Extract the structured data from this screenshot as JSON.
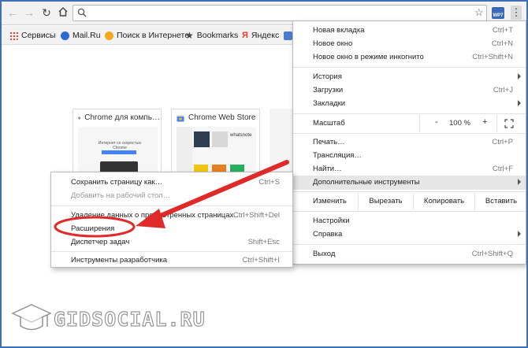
{
  "toolbar": {
    "address_value": "",
    "menu_glyph": "⋮",
    "ext_badge": "WP7"
  },
  "bookmarks": [
    {
      "label": "Сервисы",
      "color": "#e04b3b"
    },
    {
      "label": "Mail.Ru",
      "color": "#2a6bd6"
    },
    {
      "label": "Поиск в Интернете",
      "color": "#f2a91a"
    },
    {
      "label": "Bookmarks",
      "color": "#444444"
    },
    {
      "label": "Яндекс",
      "color": "#e23b2f"
    }
  ],
  "tiles": [
    {
      "title": "Chrome для компь…",
      "thumb_text": "Интернет со скоростью Chrome"
    },
    {
      "title": "Chrome Web Store",
      "thumb_text": "whatsnote"
    }
  ],
  "main_menu": {
    "new_tab": {
      "label": "Новая вкладка",
      "shortcut": "Ctrl+T"
    },
    "new_window": {
      "label": "Новое окно",
      "shortcut": "Ctrl+N"
    },
    "incognito": {
      "label": "Новое окно в режиме инкогнито",
      "shortcut": "Ctrl+Shift+N"
    },
    "history": {
      "label": "История"
    },
    "downloads": {
      "label": "Загрузки",
      "shortcut": "Ctrl+J"
    },
    "bookmarks": {
      "label": "Закладки"
    },
    "zoom": {
      "label": "Масштаб",
      "minus": "-",
      "value": "100 %",
      "plus": "+"
    },
    "print": {
      "label": "Печать…",
      "shortcut": "Ctrl+P"
    },
    "cast": {
      "label": "Трансляция…"
    },
    "find": {
      "label": "Найти…",
      "shortcut": "Ctrl+F"
    },
    "more_tools": {
      "label": "Дополнительные инструменты"
    },
    "edit": {
      "label": "Изменить",
      "cut": "Вырезать",
      "copy": "Копировать",
      "paste": "Вставить"
    },
    "settings": {
      "label": "Настройки"
    },
    "help": {
      "label": "Справка"
    },
    "exit": {
      "label": "Выход",
      "shortcut": "Ctrl+Shift+Q"
    }
  },
  "sub_menu": {
    "save_page": {
      "label": "Сохранить страницу как…",
      "shortcut": "Ctrl+S"
    },
    "add_desktop": {
      "label": "Добавить на рабочий стол…"
    },
    "clear_data": {
      "label": "Удаление данных о просмотренных страницах…",
      "shortcut": "Ctrl+Shift+Del"
    },
    "extensions": {
      "label": "Расширения"
    },
    "task_manager": {
      "label": "Диспетчер задач",
      "shortcut": "Shift+Esc"
    },
    "dev_tools": {
      "label": "Инструменты разработчика",
      "shortcut": "Ctrl+Shift+I"
    }
  },
  "watermark": {
    "text": "GIDSOCIAL.RU"
  },
  "colors": {
    "frame": "#3d6fb4",
    "highlight_ring": "#e02a2a",
    "arrow": "#e02a2a"
  }
}
